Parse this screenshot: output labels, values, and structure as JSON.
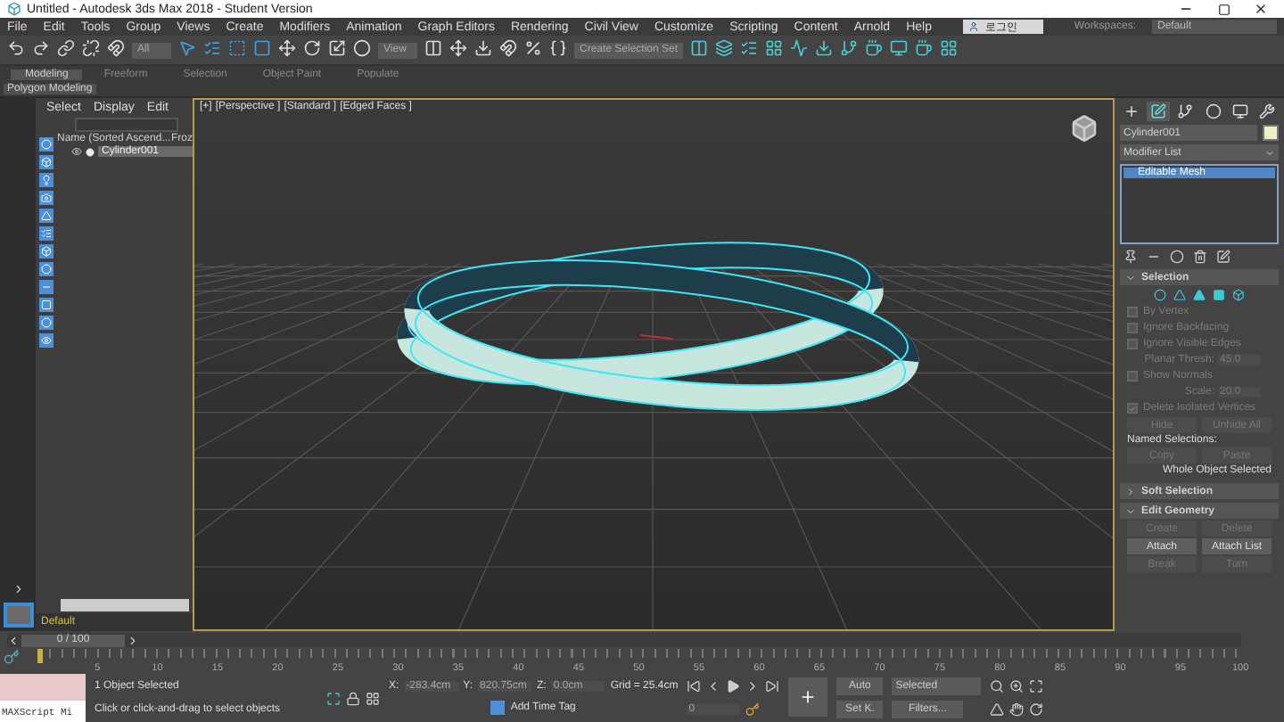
{
  "window": {
    "title": "Untitled - Autodesk 3ds Max 2018 - Student Version"
  },
  "menu": [
    "File",
    "Edit",
    "Tools",
    "Group",
    "Views",
    "Create",
    "Modifiers",
    "Animation",
    "Graph Editors",
    "Rendering",
    "Civil View",
    "Customize",
    "Scripting",
    "Content",
    "Arnold",
    "Help"
  ],
  "account": {
    "name": "로그인"
  },
  "workspace": {
    "label": "Workspaces:",
    "value": "Default"
  },
  "toolbar": {
    "filter": "All",
    "coord": "View",
    "selection_set": "Create Selection Set"
  },
  "ribbon": {
    "tabs": [
      {
        "label": "Modeling",
        "selected": true
      },
      {
        "label": "Freeform",
        "selected": false
      },
      {
        "label": "Selection",
        "selected": false
      },
      {
        "label": "Object Paint",
        "selected": false
      },
      {
        "label": "Populate",
        "selected": false
      }
    ],
    "panel": "Polygon Modeling"
  },
  "explorer": {
    "menu": [
      "Select",
      "Display",
      "Edit"
    ],
    "columns": [
      "Name (Sorted Ascend...",
      "Froz"
    ],
    "rows": [
      {
        "name": "Cylinder001",
        "selected": true
      }
    ],
    "layer": "Default"
  },
  "viewport": {
    "labels": [
      "[+]",
      "[Perspective ]",
      "[Standard ]",
      "[Edged Faces ]"
    ]
  },
  "command_panel": {
    "tabs": [
      {
        "kind": "create",
        "selected": false
      },
      {
        "kind": "modify",
        "selected": true
      },
      {
        "kind": "hierarchy",
        "selected": false
      },
      {
        "kind": "motion",
        "selected": false
      },
      {
        "kind": "display",
        "selected": false
      },
      {
        "kind": "utilities",
        "selected": false
      }
    ],
    "object_name": "Cylinder001",
    "modifier_list": "Modifier List",
    "stack": [
      {
        "label": "Editable Mesh",
        "selected": true
      }
    ],
    "rollouts": [
      {
        "title": "Selection",
        "expanded": true,
        "items": [
          {
            "kind": "subobjects"
          },
          {
            "kind": "check",
            "label": "By Vertex",
            "checked": false,
            "disabled": true
          },
          {
            "kind": "check",
            "label": "Ignore Backfacing",
            "checked": false,
            "disabled": true
          },
          {
            "kind": "check",
            "label": "Ignore Visible Edges",
            "checked": false,
            "disabled": true
          },
          {
            "kind": "spinner",
            "label": "Planar Thresh:",
            "value": "45.0"
          },
          {
            "kind": "check",
            "label": "Show Normals",
            "checked": false,
            "disabled": true
          },
          {
            "kind": "spinner",
            "label": "Scale:",
            "value": "20.0"
          },
          {
            "kind": "check",
            "label": "Delete Isolated Vertices",
            "checked": true,
            "disabled": true
          },
          {
            "kind": "buttons",
            "buttons": [
              {
                "label": "Hide",
                "disabled": true
              },
              {
                "label": "Unhide All",
                "disabled": true
              }
            ]
          },
          {
            "kind": "label",
            "label": "Named Selections:"
          },
          {
            "kind": "buttons",
            "buttons": [
              {
                "label": "Copy",
                "disabled": true
              },
              {
                "label": "Paste",
                "disabled": true
              }
            ]
          },
          {
            "kind": "note",
            "label": "Whole Object Selected"
          }
        ]
      },
      {
        "title": "Soft Selection",
        "expanded": false
      },
      {
        "title": "Edit Geometry",
        "expanded": true,
        "items": [
          {
            "kind": "buttons",
            "buttons": [
              {
                "label": "Create",
                "disabled": true
              },
              {
                "label": "Delete",
                "disabled": true
              }
            ]
          },
          {
            "kind": "buttons",
            "buttons": [
              {
                "label": "Attach",
                "disabled": false
              },
              {
                "label": "Attach List",
                "disabled": false
              }
            ]
          },
          {
            "kind": "buttons",
            "buttons": [
              {
                "label": "Break",
                "disabled": true
              },
              {
                "label": "Turn",
                "disabled": true
              }
            ]
          }
        ]
      }
    ]
  },
  "timeline": {
    "frame": "0 / 100",
    "ticks": [
      "5",
      "10",
      "15",
      "20",
      "25",
      "30",
      "35",
      "40",
      "45",
      "50",
      "55",
      "60",
      "65",
      "70",
      "75",
      "80",
      "85",
      "90",
      "95",
      "100"
    ]
  },
  "status": {
    "maxscript": "MAXScript Mi",
    "selected": "1 Object Selected",
    "prompt": "Click or click-and-drag to select objects",
    "coords": [
      {
        "label": "X:",
        "value": "-283.4cm"
      },
      {
        "label": "Y:",
        "value": "820.75cm"
      },
      {
        "label": "Z:",
        "value": "0.0cm"
      }
    ],
    "grid": "Grid = 25.4cm",
    "time_tag": "Add Time Tag",
    "frame": "0",
    "auto": "Auto",
    "set_key": "Set K.",
    "key_filter": "Selected",
    "filters": "Filters..."
  }
}
